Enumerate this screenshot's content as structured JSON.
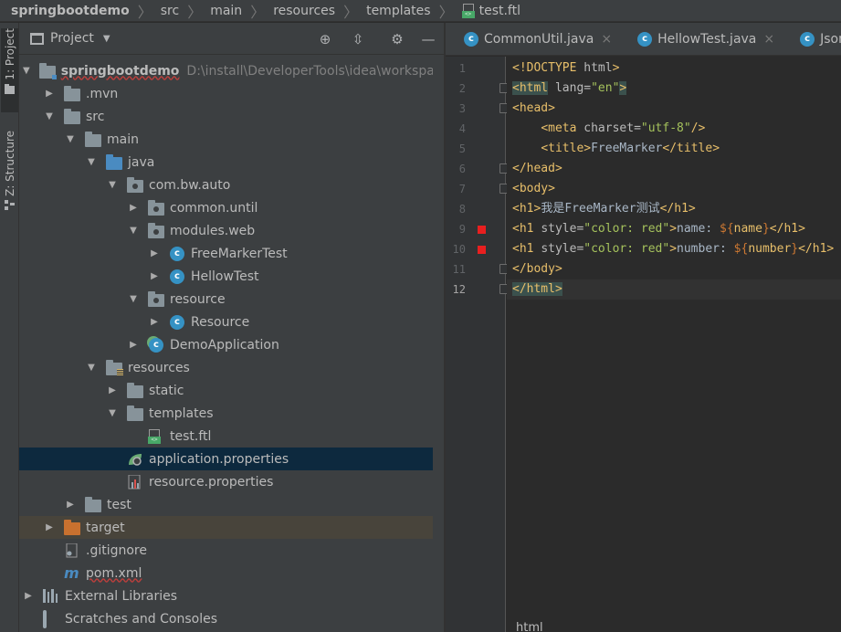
{
  "breadcrumb": [
    "springbootdemo",
    "src",
    "main",
    "resources",
    "templates",
    "test.ftl"
  ],
  "left_strip": {
    "project_tab": "1: Project",
    "structure_tab": "Z: Structure"
  },
  "project_panel": {
    "title": "Project",
    "tree": [
      {
        "label": "springbootdemo",
        "path": "D:\\install\\DeveloperTools\\idea\\workspace\\",
        "depth": 0,
        "arrow": "open",
        "icon": "module-folder"
      },
      {
        "label": ".mvn",
        "depth": 1,
        "arrow": "closed",
        "icon": "folder"
      },
      {
        "label": "src",
        "depth": 1,
        "arrow": "open",
        "icon": "folder"
      },
      {
        "label": "main",
        "depth": 2,
        "arrow": "open",
        "icon": "folder"
      },
      {
        "label": "java",
        "depth": 3,
        "arrow": "open",
        "icon": "source-folder"
      },
      {
        "label": "com.bw.auto",
        "depth": 4,
        "arrow": "open",
        "icon": "package"
      },
      {
        "label": "common.until",
        "depth": 5,
        "arrow": "closed",
        "icon": "package"
      },
      {
        "label": "modules.web",
        "depth": 5,
        "arrow": "open",
        "icon": "package"
      },
      {
        "label": "FreeMarkerTest",
        "depth": 6,
        "arrow": "closed",
        "icon": "class"
      },
      {
        "label": "HellowTest",
        "depth": 6,
        "arrow": "closed",
        "icon": "class"
      },
      {
        "label": "resource",
        "depth": 5,
        "arrow": "open",
        "icon": "package"
      },
      {
        "label": "Resource",
        "depth": 6,
        "arrow": "closed",
        "icon": "class"
      },
      {
        "label": "DemoApplication",
        "depth": 5,
        "arrow": "closed",
        "icon": "spring-class"
      },
      {
        "label": "resources",
        "depth": 3,
        "arrow": "open",
        "icon": "resources-folder"
      },
      {
        "label": "static",
        "depth": 4,
        "arrow": "closed",
        "icon": "folder"
      },
      {
        "label": "templates",
        "depth": 4,
        "arrow": "open",
        "icon": "folder"
      },
      {
        "label": "test.ftl",
        "depth": 5,
        "arrow": "none",
        "icon": "ftl-file"
      },
      {
        "label": "application.properties",
        "depth": 4,
        "arrow": "none",
        "icon": "spring-properties",
        "selected": true
      },
      {
        "label": "resource.properties",
        "depth": 4,
        "arrow": "none",
        "icon": "properties-file"
      },
      {
        "label": "test",
        "depth": 2,
        "arrow": "closed",
        "icon": "folder"
      },
      {
        "label": "target",
        "depth": 1,
        "arrow": "closed",
        "icon": "excluded-folder",
        "excluded": true
      },
      {
        "label": ".gitignore",
        "depth": 1,
        "arrow": "none",
        "icon": "text-file"
      },
      {
        "label": "pom.xml",
        "depth": 1,
        "arrow": "none",
        "icon": "maven-file"
      },
      {
        "label": "External Libraries",
        "depth": 0,
        "arrow": "closed",
        "icon": "library"
      },
      {
        "label": "Scratches and Consoles",
        "depth": 0,
        "arrow": "none",
        "icon": "scratch"
      }
    ]
  },
  "editor": {
    "tabs": [
      {
        "label": "CommonUtil.java",
        "close": "×"
      },
      {
        "label": "HellowTest.java",
        "close": "×"
      },
      {
        "label": "JsonUti",
        "close": ""
      }
    ],
    "lines": [
      {
        "n": "1",
        "text": "<!DOCTYPE html>"
      },
      {
        "n": "2",
        "text": "<html lang=\"en\">"
      },
      {
        "n": "3",
        "text": "<head>"
      },
      {
        "n": "4",
        "text": "    <meta charset=\"utf-8\"/>"
      },
      {
        "n": "5",
        "text": "    <title>FreeMarker</title>"
      },
      {
        "n": "6",
        "text": "</head>"
      },
      {
        "n": "7",
        "text": "<body>"
      },
      {
        "n": "8",
        "text": "<h1>我是FreeMarker测试</h1>"
      },
      {
        "n": "9",
        "text": "<h1 style=\"color: red\">name: ${name}</h1>"
      },
      {
        "n": "10",
        "text": "<h1 style=\"color: red\">number: ${number}</h1>"
      },
      {
        "n": "11",
        "text": "</body>"
      },
      {
        "n": "12",
        "text": "</html>"
      }
    ],
    "current_line": "12",
    "breakpoint_lines": [
      "9",
      "10"
    ],
    "bottom_hint": "html"
  },
  "colors": {
    "selection": "#0d293e",
    "tag": "#e8bf6a",
    "attr_value": "#a5c25c",
    "keyword": "#cc7832",
    "breakpoint": "#e81f1f"
  }
}
